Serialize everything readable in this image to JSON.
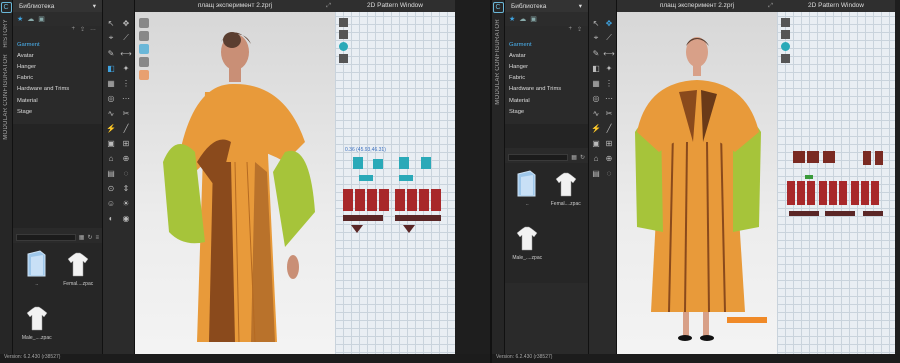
{
  "left": {
    "vertical_labels": [
      "HISTORY",
      "MODULAR CONFIGURATOR"
    ],
    "library": {
      "title": "Библиотека",
      "items": [
        "Garment",
        "Avatar",
        "Hanger",
        "Fabric",
        "Hardware and Trims",
        "Material",
        "Stage"
      ],
      "selected": "Garment",
      "files": [
        {
          "name": "..",
          "type": "folder"
        },
        {
          "name": "Femal....zpac",
          "type": "shirt"
        },
        {
          "name": "Male_....zpac",
          "type": "shirt"
        }
      ]
    },
    "viewport_title": "плащ эксперимент 2.zprj",
    "pattern_title": "2D Pattern Window",
    "pattern_coord": "0.36 (45.93,46.31)",
    "status": "Version: 6.2.430 (r38527)"
  },
  "right": {
    "vertical_labels": [
      "MODULAR CONFIGURATOR"
    ],
    "library": {
      "title": "Библиотека",
      "items": [
        "Garment",
        "Avatar",
        "Hanger",
        "Fabric",
        "Hardware and Trims",
        "Material",
        "Stage"
      ],
      "selected": "Garment",
      "files": [
        {
          "name": "..",
          "type": "folder"
        },
        {
          "name": "Femal....zpac",
          "type": "shirt"
        },
        {
          "name": "Male_....zpac",
          "type": "shirt"
        }
      ]
    },
    "viewport_title": "плащ эксперимент 2.zprj",
    "pattern_title": "2D Pattern Window",
    "status": "Version: 6.2.430 (r38527)"
  },
  "colors": {
    "accent": "#3fa3e0",
    "coat_orange": "#e89a3a",
    "coat_dark": "#8a4a1c",
    "sleeve_green": "#a6c43a",
    "pattern_red": "#a8282a",
    "pattern_teal": "#2aa9b8"
  }
}
